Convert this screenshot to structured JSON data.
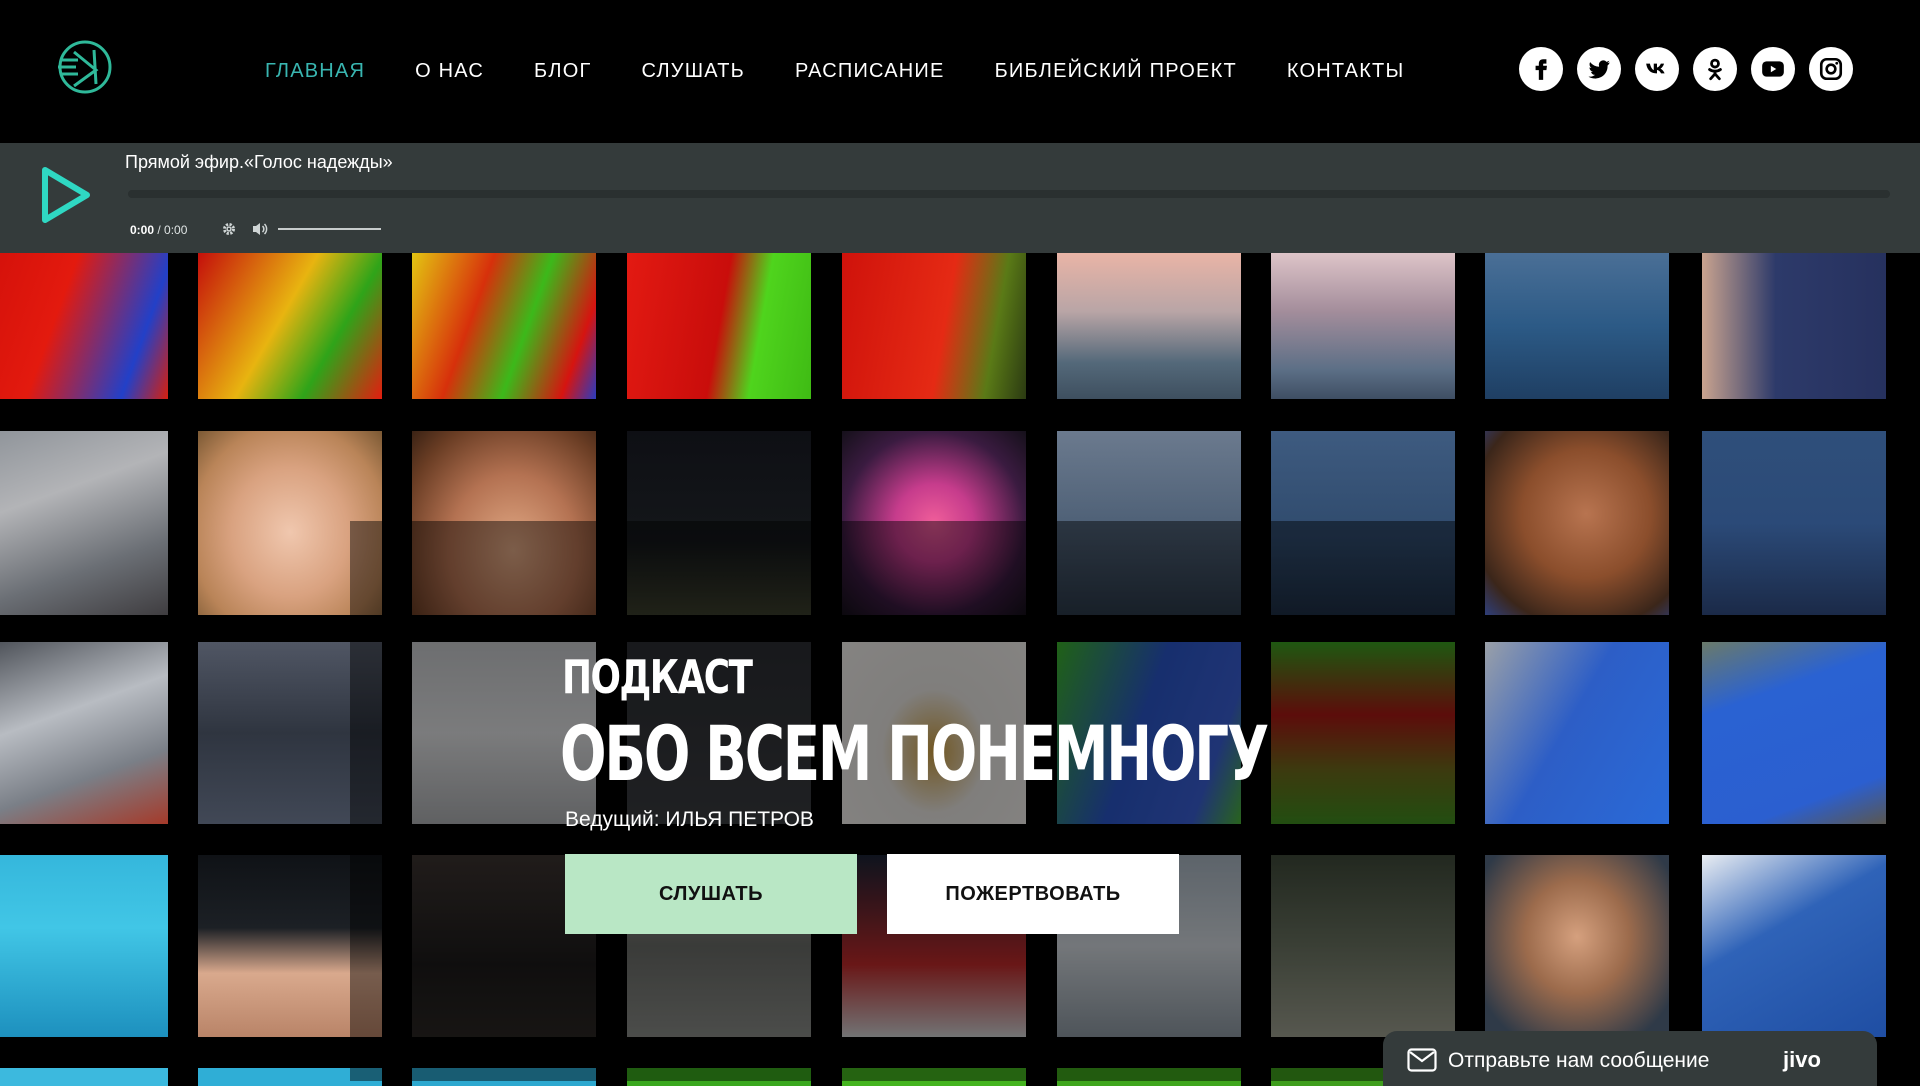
{
  "header": {
    "logo": "radio-logo-icon",
    "nav": [
      {
        "label": "ГЛАВНАЯ",
        "active": true
      },
      {
        "label": "О НАС",
        "active": false
      },
      {
        "label": "БЛОГ",
        "active": false
      },
      {
        "label": "СЛУШАТЬ",
        "active": false
      },
      {
        "label": "РАСПИСАНИЕ",
        "active": false
      },
      {
        "label": "БИБЛЕЙСКИЙ ПРОЕКТ",
        "active": false
      },
      {
        "label": "КОНТАКТЫ",
        "active": false
      }
    ],
    "social": [
      "facebook-icon",
      "twitter-icon",
      "vk-icon",
      "odnoklassniki-icon",
      "youtube-icon",
      "instagram-icon"
    ],
    "accent_color": "#39b6b1"
  },
  "player": {
    "title": "Прямой эфир.«Голос надежды»",
    "current_time": "0:00",
    "duration": "/ 0:00",
    "progress": 0
  },
  "hero": {
    "subtitle": "ПОДКАСТ",
    "title": "ОБО ВСЕМ ПОНЕМНОГУ",
    "host": "Ведущий: ИЛЬЯ ПЕТРОВ",
    "listen_label": "СЛУШАТЬ",
    "donate_label": "ПОЖЕРТВОВАТЬ",
    "listen_color": "#b9e7c5"
  },
  "chat": {
    "label": "Отправьте нам сообщение",
    "brand": "jivo"
  }
}
